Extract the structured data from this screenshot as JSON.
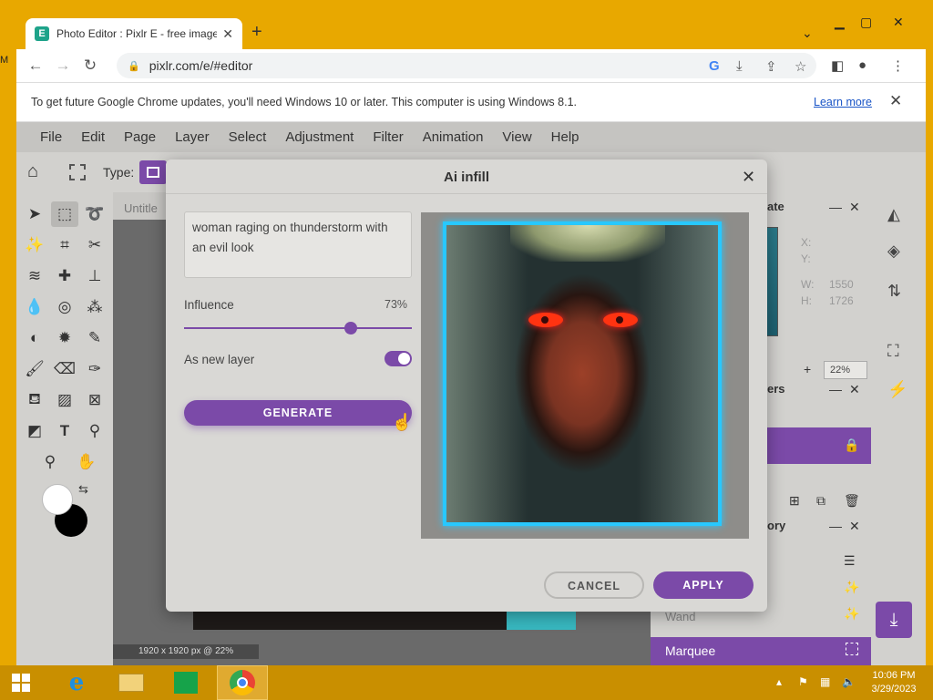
{
  "browser": {
    "tab_title": "Photo Editor : Pixlr E - free image",
    "tab_icon": "E",
    "url": "pixlr.com/e/#editor",
    "infobar_text": "To get future Google Chrome updates, you'll need Windows 10 or later. This computer is using Windows 8.1.",
    "infobar_link": "Learn more"
  },
  "menu": {
    "items": [
      "File",
      "Edit",
      "Page",
      "Layer",
      "Select",
      "Adjustment",
      "Filter",
      "Animation",
      "View",
      "Help"
    ]
  },
  "options": {
    "type_label": "Type:"
  },
  "canvas": {
    "doc_tab": "Untitle",
    "status": "1920 x 1920 px @ 22%"
  },
  "right_panel": {
    "navigator_title": "ate",
    "x_label": "X:",
    "y_label": "Y:",
    "w_label": "W:",
    "w_value": "1550",
    "h_label": "H:",
    "h_value": "1726",
    "zoom": "22%",
    "layers_title": "ers",
    "history_title": "ory",
    "history_partial": "Wand",
    "history_active": "Marquee"
  },
  "dialog": {
    "title": "Ai infill",
    "prompt": "woman raging on thunderstorm with an evil look",
    "influence_label": "Influence",
    "influence_value": "73%",
    "influence": 0.73,
    "as_new_layer_label": "As new layer",
    "as_new_layer": true,
    "generate_label": "GENERATE",
    "cancel_label": "CANCEL",
    "apply_label": "APPLY"
  },
  "taskbar": {
    "time": "10:06 PM",
    "date": "3/29/2023"
  },
  "desktop": {
    "edge_letter": "M"
  },
  "colors": {
    "accent": "#7b4aa8",
    "preview_border": "#28c8ff",
    "desktop": "#e8a800"
  }
}
